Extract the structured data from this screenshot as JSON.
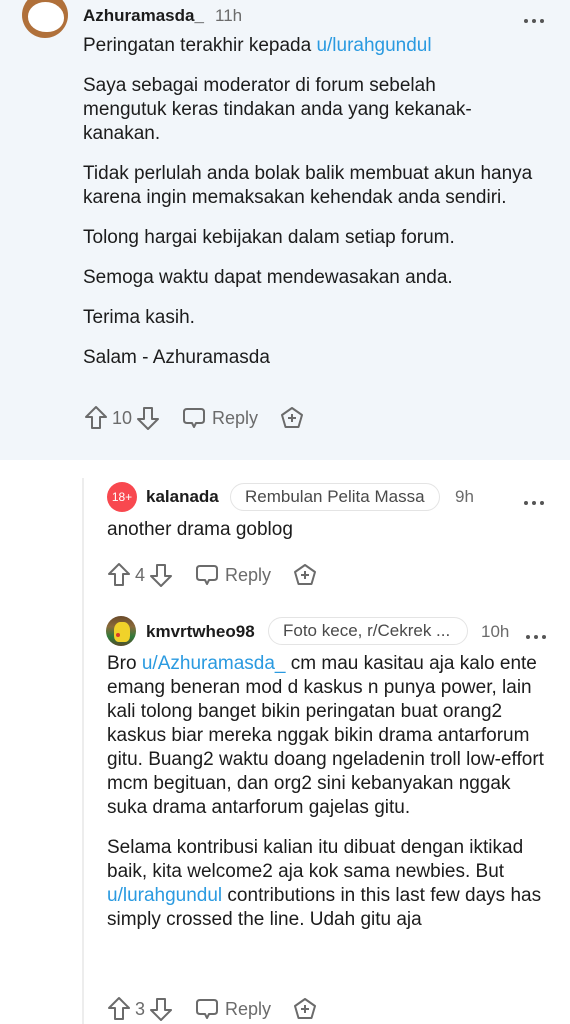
{
  "comments": [
    {
      "author": "Azhuramasda_",
      "time": "11h",
      "avatar_icon": "snoo-avatar-icon",
      "paragraphs": [
        {
          "text": "Peringatan terakhir kepada ",
          "mention": "u/lurahgundul"
        },
        {
          "text": "Saya sebagai moderator di forum sebelah mengutuk keras tindakan anda yang kekanak-kanakan."
        },
        {
          "text": "Tidak perlulah anda bolak balik membuat akun hanya karena ingin memaksakan kehendak anda sendiri."
        },
        {
          "text": "Tolong hargai kebijakan dalam setiap forum."
        },
        {
          "text": "Semoga waktu dapat mendewasakan anda."
        },
        {
          "text": "Terima kasih."
        },
        {
          "text": "Salam - Azhuramasda"
        }
      ],
      "votes": "10",
      "reply_label": "Reply"
    },
    {
      "author": "kalanada",
      "badge": "18+",
      "flair": "Rembulan Pelita Massa",
      "time": "9h",
      "body": "another drama goblog",
      "votes": "4",
      "reply_label": "Reply"
    },
    {
      "author": "kmvrtwheo98",
      "avatar_icon": "pikachu-avatar-icon",
      "flair": "Foto kece, r/Cekrek ...",
      "time": "10h",
      "p1_before": "Bro ",
      "p1_mention": "u/Azhuramasda_",
      "p1_after": " cm mau kasitau aja kalo ente emang beneran mod d kaskus n punya power, lain kali tolong banget bikin peringatan buat orang2 kaskus biar mereka nggak bikin drama antarforum gitu. Buang2 waktu doang ngeladenin troll low-effort mcm begituan, dan org2 sini kebanyakan nggak suka drama antarforum gajelas gitu.",
      "p2_before": "Selama kontribusi kalian itu dibuat dengan iktikad baik, kita welcome2 aja kok sama newbies. But ",
      "p2_mention": "u/lurahgundul",
      "p2_after": " contributions in this last few days has simply crossed the line. Udah gitu aja",
      "votes": "3",
      "reply_label": "Reply"
    }
  ],
  "colors": {
    "link": "#2a9ae0",
    "nsfw": "#f8484f",
    "highlight_bg": "#f2f6fa"
  }
}
